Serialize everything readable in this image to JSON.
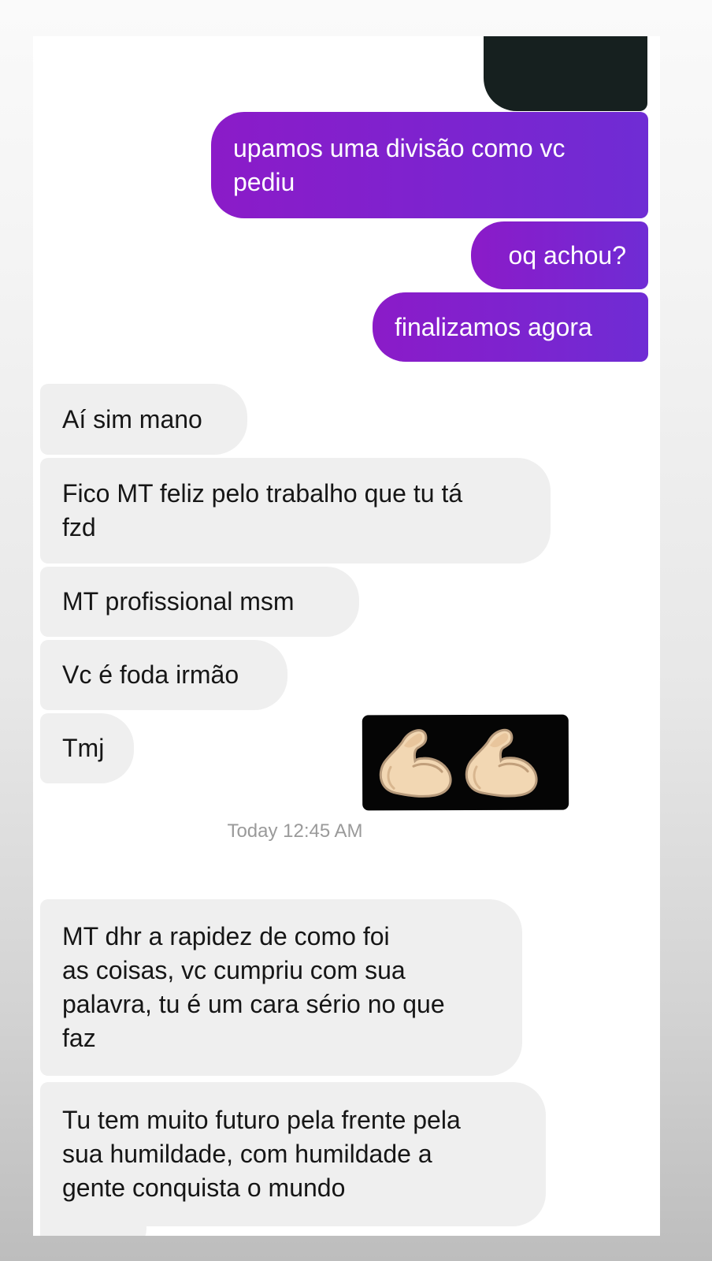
{
  "conversation": {
    "sent_messages": [
      "upamos uma divisão como vc\npediu",
      "oq achou?",
      "finalizamos agora"
    ],
    "received_messages_before_time": [
      "Aí sim mano",
      "Fico MT feliz pelo trabalho que tu tá\nfzd",
      "MT profissional msm",
      "Vc é foda irmão",
      "Tmj"
    ],
    "timestamp": "Today 12:45 AM",
    "received_messages_after_time": [
      "MT dhr a rapidez de como foi\nas coisas, vc cumpriu com sua\npalavra, tu é um cara sério no que\nfaz",
      "Tu tem muito futuro pela frente pela\nsua humildade, com humildade a\ngente conquista o mundo"
    ],
    "sticker": {
      "icon": "flexed-biceps-icon",
      "background": "#050505"
    }
  },
  "colors": {
    "sent_bubble_start": "#8b1bc8",
    "sent_bubble_end": "#6f2cd4",
    "received_bubble": "#efefef",
    "text_dark": "#161616",
    "timestamp": "#9a9a9a"
  }
}
